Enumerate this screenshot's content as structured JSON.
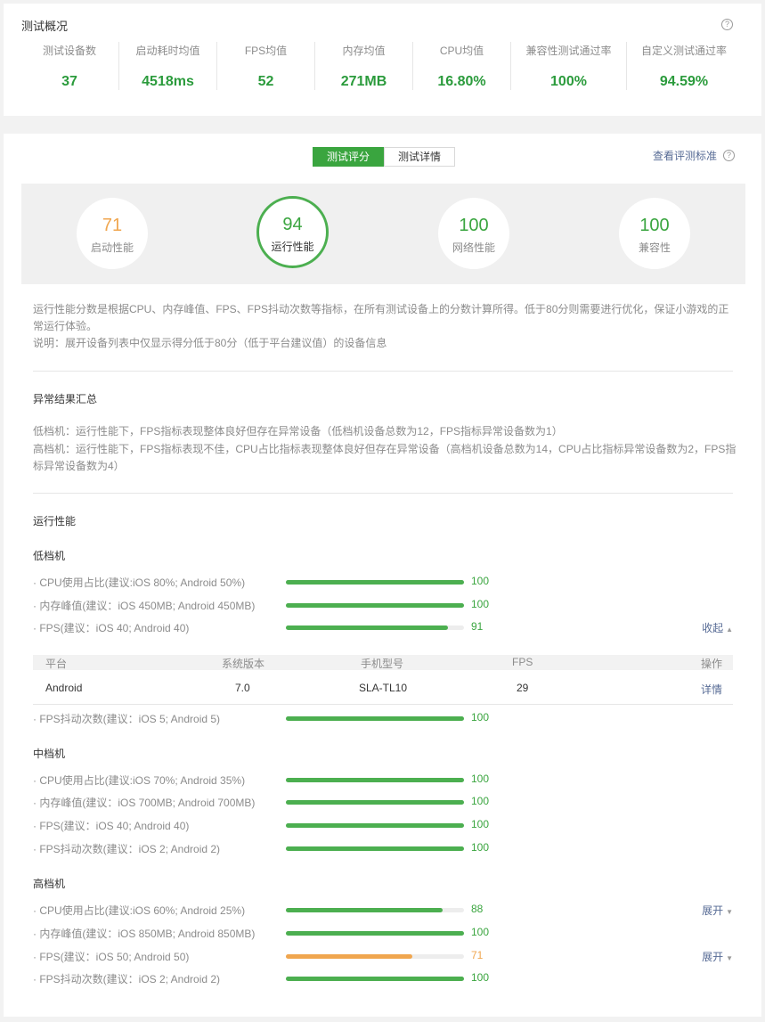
{
  "overview": {
    "title": "测试概况",
    "help": "?",
    "stats": [
      {
        "label": "测试设备数",
        "value": "37"
      },
      {
        "label": "启动耗时均值",
        "value": "4518ms"
      },
      {
        "label": "FPS均值",
        "value": "52"
      },
      {
        "label": "内存均值",
        "value": "271MB"
      },
      {
        "label": "CPU均值",
        "value": "16.80%"
      },
      {
        "label": "兼容性测试通过率",
        "value": "100%"
      },
      {
        "label": "自定义测试通过率",
        "value": "94.59%"
      }
    ]
  },
  "tabs": [
    {
      "label": "测试评分",
      "active": true
    },
    {
      "label": "测试详情",
      "active": false
    }
  ],
  "criteria_link": "查看评测标准",
  "scores": [
    {
      "value": "71",
      "label": "启动性能"
    },
    {
      "value": "94",
      "label": "运行性能"
    },
    {
      "value": "100",
      "label": "网络性能"
    },
    {
      "value": "100",
      "label": "兼容性"
    }
  ],
  "description": {
    "line1": "运行性能分数是根据CPU、内存峰值、FPS、FPS抖动次数等指标，在所有测试设备上的分数计算所得。低于80分则需要进行优化，保证小游戏的正常运行体验。",
    "line2": "说明：展开设备列表中仅显示得分低于80分（低于平台建议值）的设备信息"
  },
  "anomaly": {
    "title": "异常结果汇总",
    "low": "低档机：运行性能下，FPS指标表现整体良好但存在异常设备（低档机设备总数为12，FPS指标异常设备数为1）",
    "high": "高档机：运行性能下，FPS指标表现不佳，CPU占比指标表现整体良好但存在异常设备（高档机设备总数为14，CPU占比指标异常设备数为2，FPS指标异常设备数为4）"
  },
  "runtime": {
    "title": "运行性能",
    "low": {
      "title": "低档机",
      "metrics": [
        {
          "name": "· CPU使用占比(建议:iOS 80%; Android 50%)",
          "score": "100",
          "level": 1.0
        },
        {
          "name": "· 内存峰值(建议：iOS 450MB; Android 450MB)",
          "score": "100",
          "level": 1.0
        },
        {
          "name": "· FPS(建议：iOS 40; Android 40)",
          "score": "91",
          "level": 0.91,
          "toggle": "收起",
          "toggle_arrow": "▲"
        },
        {
          "name": "· FPS抖动次数(建议：iOS 5; Android 5)",
          "score": "100",
          "level": 1.0
        }
      ],
      "table": {
        "headers": [
          "平台",
          "系统版本",
          "手机型号",
          "FPS",
          "操作"
        ],
        "rows": [
          {
            "platform": "Android",
            "os": "7.0",
            "model": "SLA-TL10",
            "fps": "29",
            "action": "详情"
          }
        ]
      }
    },
    "mid": {
      "title": "中档机",
      "metrics": [
        {
          "name": "· CPU使用占比(建议:iOS 70%; Android 35%)",
          "score": "100",
          "level": 1.0
        },
        {
          "name": "· 内存峰值(建议：iOS 700MB; Android 700MB)",
          "score": "100",
          "level": 1.0
        },
        {
          "name": "· FPS(建议：iOS 40; Android 40)",
          "score": "100",
          "level": 1.0
        },
        {
          "name": "· FPS抖动次数(建议：iOS 2; Android 2)",
          "score": "100",
          "level": 1.0
        }
      ]
    },
    "high": {
      "title": "高档机",
      "metrics": [
        {
          "name": "· CPU使用占比(建议:iOS 60%; Android 25%)",
          "score": "88",
          "level": 0.88,
          "toggle": "展开",
          "toggle_arrow": "▼"
        },
        {
          "name": "· 内存峰值(建议：iOS 850MB; Android 850MB)",
          "score": "100",
          "level": 1.0
        },
        {
          "name": "· FPS(建议：iOS 50; Android 50)",
          "score": "71",
          "level": 0.71,
          "warn": true,
          "toggle": "展开",
          "toggle_arrow": "▼"
        },
        {
          "name": "· FPS抖动次数(建议：iOS 2; Android 2)",
          "score": "100",
          "level": 1.0
        }
      ]
    }
  },
  "colors": {
    "good": "#4caf50",
    "warn": "#f0a64f",
    "link": "#576b95"
  }
}
